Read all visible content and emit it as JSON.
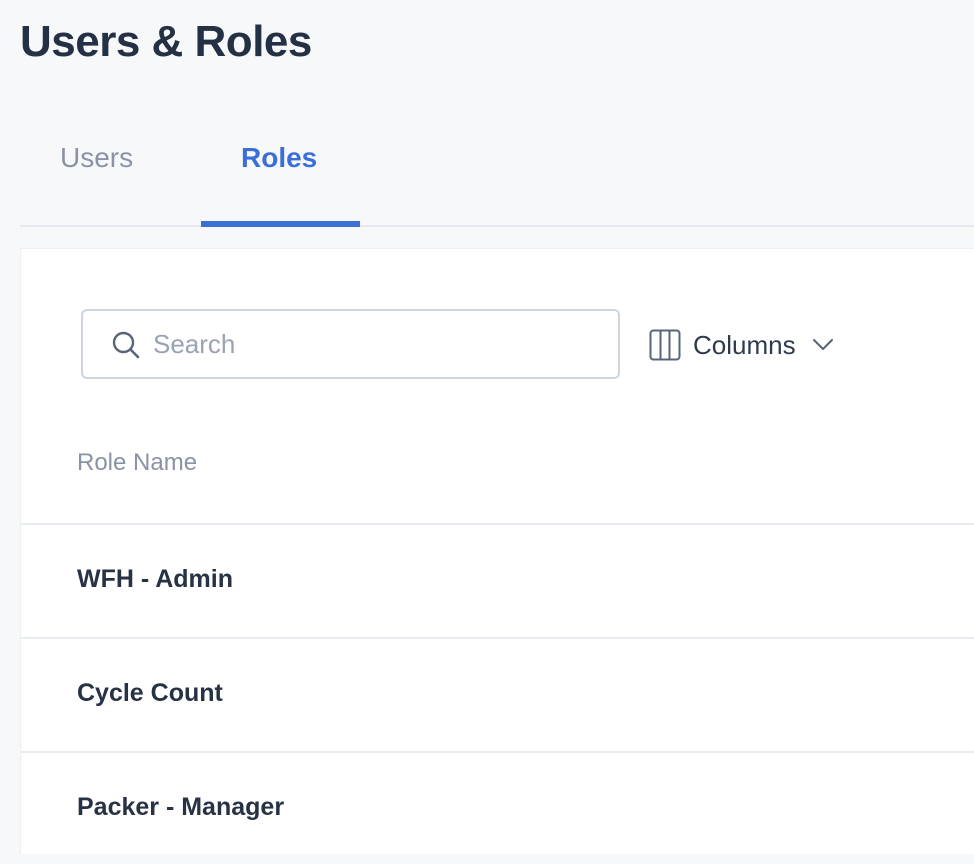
{
  "page": {
    "title": "Users & Roles"
  },
  "tabs": [
    {
      "label": "Users",
      "active": false
    },
    {
      "label": "Roles",
      "active": true
    }
  ],
  "toolbar": {
    "search_placeholder": "Search",
    "search_value": "",
    "columns_label": "Columns"
  },
  "table": {
    "columns": [
      "Role Name"
    ],
    "rows": [
      {
        "role_name": "WFH - Admin"
      },
      {
        "role_name": "Cycle Count"
      },
      {
        "role_name": "Packer - Manager"
      }
    ]
  },
  "colors": {
    "accent": "#3b6fd8",
    "title": "#243044",
    "muted": "#8a93a6",
    "background": "#f7f8fa"
  },
  "icons": {
    "search": "search-icon",
    "columns": "columns-icon",
    "chevron": "chevron-down-icon"
  }
}
